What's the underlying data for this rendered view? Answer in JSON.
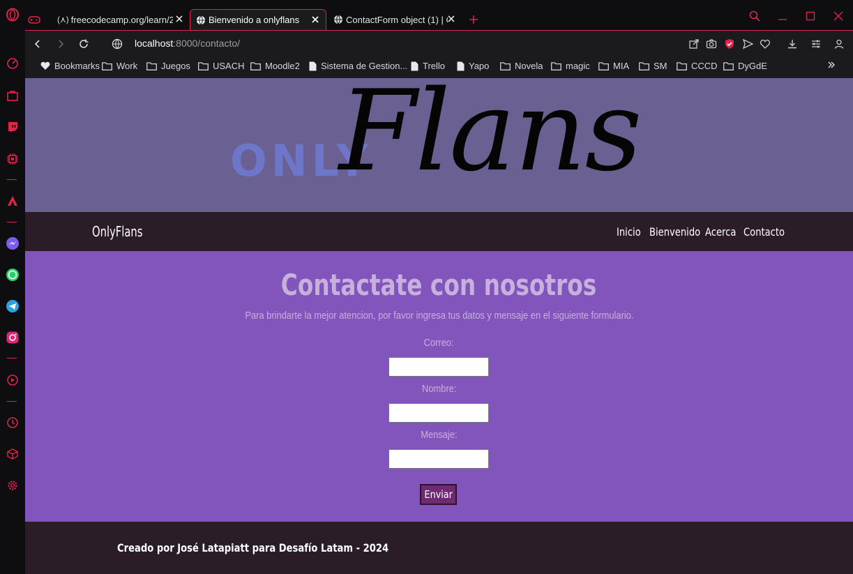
{
  "browser": {
    "tabs": [
      {
        "title": "freecodecamp.org/learn/20",
        "active": false
      },
      {
        "title": "Bienvenido a onlyflans",
        "active": true
      },
      {
        "title": "ContactForm object (1) | Cl",
        "active": false
      }
    ],
    "address": {
      "host": "localhost",
      "rest": ":8000/contacto/"
    },
    "bookmarks": [
      "Bookmarks",
      "Work",
      "Juegos",
      "USACH",
      "Moodle2",
      "Sistema de Gestion...",
      "Trello",
      "Yapo",
      "Novela",
      "magic",
      "MIA",
      "SM",
      "CCCD",
      "DyGdE"
    ],
    "accent_color": "#e0244a"
  },
  "site": {
    "logo": {
      "word1": "ONLY",
      "word2": "Flans"
    },
    "brand": "OnlyFlans",
    "nav": [
      "Inicio",
      "Bienvenido",
      "Acerca",
      "Contacto"
    ],
    "heading": "Contactate con nosotros",
    "lead": "Para brindarte la mejor atencion, por favor ingresa tus datos y mensaje en el siguiente formulario.",
    "form": {
      "correo_label": "Correo:",
      "nombre_label": "Nombre:",
      "mensaje_label": "Mensaje:",
      "correo_value": "",
      "nombre_value": "",
      "mensaje_value": "",
      "submit": "Enviar"
    },
    "footer": "Creado por José Latapiatt para Desafío Latam - 2024",
    "colors": {
      "hero": "#6a6192",
      "nav": "#2a1d28",
      "content": "#8255bd",
      "button": "#6e2a73"
    }
  }
}
